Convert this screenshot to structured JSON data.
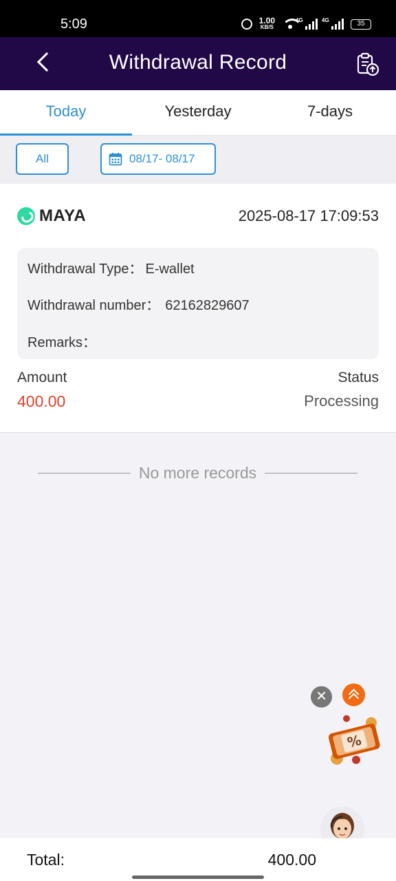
{
  "status_bar": {
    "time": "5:09",
    "net_speed": "1.00",
    "net_unit": "KB/S",
    "signal_1": "4G",
    "signal_2": "4G",
    "battery": "35"
  },
  "header": {
    "title": "Withdrawal Record",
    "back_icon": "chevron-left-icon",
    "right_icon": "clipboard-upload-icon"
  },
  "tabs": [
    {
      "label": "Today",
      "active": true
    },
    {
      "label": "Yesterday",
      "active": false
    },
    {
      "label": "7-days",
      "active": false
    }
  ],
  "filters": {
    "type_label": "All",
    "date_range": "08/17- 08/17",
    "date_icon": "calendar-icon"
  },
  "records": [
    {
      "method": "MAYA",
      "method_icon": "maya-logo-icon",
      "datetime": "2025-08-17 17:09:53",
      "type_label": "Withdrawal Type：",
      "type_value": "E-wallet",
      "number_label": "Withdrawal number：",
      "number_value": "62162829607",
      "remarks_label": "Remarks：",
      "remarks_value": "",
      "amount_label": "Amount",
      "amount_value": "400.00",
      "status_label": "Status",
      "status_value": "Processing"
    }
  ],
  "list_end_text": "No more records",
  "floating": {
    "close_symbol": "✕",
    "close_icon": "close-icon",
    "scroll_top_icon": "double-chevron-up-icon",
    "promo_icon": "discount-coupon-icon",
    "support_icon": "support-avatar-icon"
  },
  "footer": {
    "total_label": "Total:",
    "total_value": "400.00"
  },
  "colors": {
    "header_bg": "#210846",
    "accent": "#2c8fd6",
    "amount": "#e0412c",
    "scroll_top": "#f26a12"
  }
}
